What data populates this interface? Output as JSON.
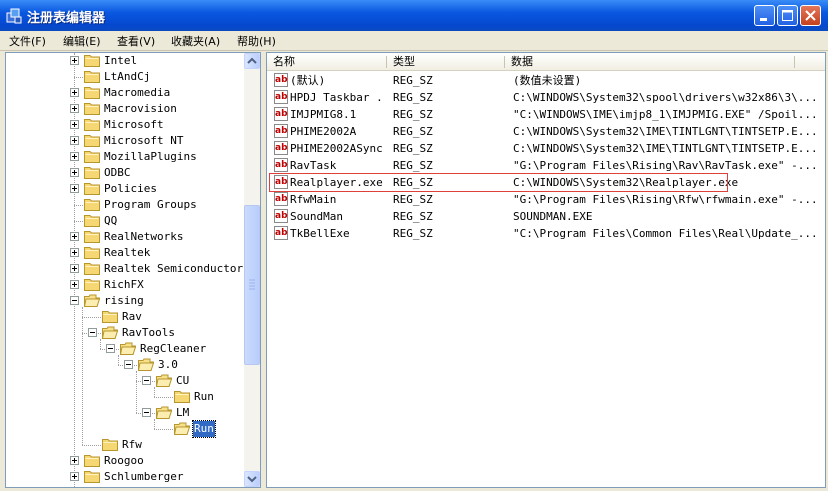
{
  "window": {
    "title": "注册表编辑器",
    "icon": "registry-editor-icon",
    "accent": "#0a58e0"
  },
  "menu": [
    {
      "label": "文件(F)"
    },
    {
      "label": "编辑(E)"
    },
    {
      "label": "查看(V)"
    },
    {
      "label": "收藏夹(A)"
    },
    {
      "label": "帮助(H)"
    }
  ],
  "tree": {
    "items": [
      {
        "label": "Intel",
        "level": 0,
        "expander": "plus"
      },
      {
        "label": "LtAndCj",
        "level": 0,
        "expander": "none"
      },
      {
        "label": "Macromedia",
        "level": 0,
        "expander": "plus"
      },
      {
        "label": "Macrovision",
        "level": 0,
        "expander": "plus"
      },
      {
        "label": "Microsoft",
        "level": 0,
        "expander": "plus"
      },
      {
        "label": "Microsoft NT",
        "level": 0,
        "expander": "plus"
      },
      {
        "label": "MozillaPlugins",
        "level": 0,
        "expander": "plus"
      },
      {
        "label": "ODBC",
        "level": 0,
        "expander": "plus"
      },
      {
        "label": "Policies",
        "level": 0,
        "expander": "plus"
      },
      {
        "label": "Program Groups",
        "level": 0,
        "expander": "none"
      },
      {
        "label": "QQ",
        "level": 0,
        "expander": "none"
      },
      {
        "label": "RealNetworks",
        "level": 0,
        "expander": "plus"
      },
      {
        "label": "Realtek",
        "level": 0,
        "expander": "plus"
      },
      {
        "label": "Realtek Semiconductor C",
        "level": 0,
        "expander": "plus"
      },
      {
        "label": "RichFX",
        "level": 0,
        "expander": "plus"
      },
      {
        "label": "rising",
        "level": 0,
        "expander": "minus"
      },
      {
        "label": "Rav",
        "level": 1,
        "expander": "none"
      },
      {
        "label": "RavTools",
        "level": 1,
        "expander": "minus"
      },
      {
        "label": "RegCleaner",
        "level": 2,
        "expander": "minus"
      },
      {
        "label": "3.0",
        "level": 3,
        "expander": "minus"
      },
      {
        "label": "CU",
        "level": 4,
        "expander": "minus"
      },
      {
        "label": "Run",
        "level": 5,
        "expander": "none"
      },
      {
        "label": "LM",
        "level": 4,
        "expander": "minus"
      },
      {
        "label": "Run",
        "level": 5,
        "expander": "none",
        "selected": true
      },
      {
        "label": "Rfw",
        "level": 1,
        "expander": "none"
      },
      {
        "label": "Roogoo",
        "level": 0,
        "expander": "plus"
      },
      {
        "label": "Schlumberger",
        "level": 0,
        "expander": "plus"
      }
    ]
  },
  "list": {
    "columns": [
      {
        "label": "名称"
      },
      {
        "label": "类型"
      },
      {
        "label": "数据"
      }
    ],
    "rows": [
      {
        "name": "(默认)",
        "type": "REG_SZ",
        "data": "(数值未设置)"
      },
      {
        "name": "HPDJ Taskbar ...",
        "type": "REG_SZ",
        "data": "C:\\WINDOWS\\System32\\spool\\drivers\\w32x86\\3\\..."
      },
      {
        "name": "IMJPMIG8.1",
        "type": "REG_SZ",
        "data": "\"C:\\WINDOWS\\IME\\imjp8_1\\IMJPMIG.EXE\" /Spoil..."
      },
      {
        "name": "PHIME2002A",
        "type": "REG_SZ",
        "data": "C:\\WINDOWS\\System32\\IME\\TINTLGNT\\TINTSETP.E..."
      },
      {
        "name": "PHIME2002ASync",
        "type": "REG_SZ",
        "data": "C:\\WINDOWS\\System32\\IME\\TINTLGNT\\TINTSETP.E..."
      },
      {
        "name": "RavTask",
        "type": "REG_SZ",
        "data": "\"G:\\Program Files\\Rising\\Rav\\RavTask.exe\" -..."
      },
      {
        "name": "Realplayer.exe",
        "type": "REG_SZ",
        "data": "C:\\WINDOWS\\System32\\Realplayer.exe",
        "highlighted": true
      },
      {
        "name": "RfwMain",
        "type": "REG_SZ",
        "data": "\"G:\\Program Files\\Rising\\Rfw\\rfwmain.exe\" -..."
      },
      {
        "name": "SoundMan",
        "type": "REG_SZ",
        "data": "SOUNDMAN.EXE"
      },
      {
        "name": "TkBellExe",
        "type": "REG_SZ",
        "data": "\"C:\\Program Files\\Common Files\\Real\\Update_..."
      }
    ],
    "highlight_color": "#e0403a"
  }
}
